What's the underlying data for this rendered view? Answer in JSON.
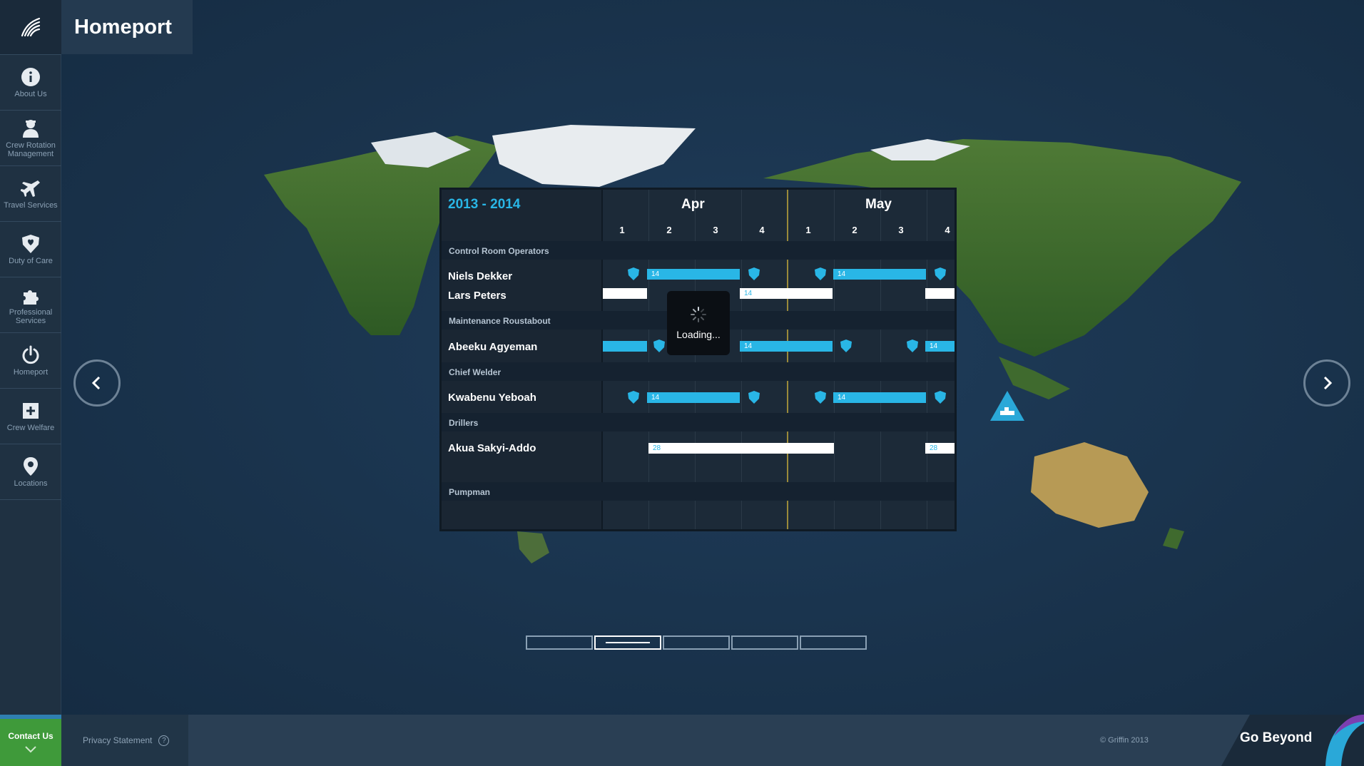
{
  "app": {
    "title": "Homeport"
  },
  "sidebar": {
    "items": [
      {
        "label": "About Us",
        "icon": "info-icon"
      },
      {
        "label": "Crew Rotation Management",
        "icon": "crew-icon"
      },
      {
        "label": "Travel Services",
        "icon": "plane-icon"
      },
      {
        "label": "Duty of Care",
        "icon": "shield-icon"
      },
      {
        "label": "Professional Services",
        "icon": "puzzle-icon"
      },
      {
        "label": "Homeport",
        "icon": "power-icon"
      },
      {
        "label": "Crew Welfare",
        "icon": "plus-box-icon"
      },
      {
        "label": "Locations",
        "icon": "location-pin-icon"
      }
    ]
  },
  "schedule": {
    "year_range": "2013 - 2014",
    "months": [
      "Apr",
      "May"
    ],
    "weeks": [
      "1",
      "2",
      "3",
      "4",
      "1",
      "2",
      "3",
      "4"
    ],
    "groups": [
      {
        "label": "Control Room Operators",
        "people": [
          "Niels Dekker",
          "Lars Peters"
        ]
      },
      {
        "label": "Maintenance Roustabout",
        "people": [
          "Abeeku Agyeman"
        ]
      },
      {
        "label": "Chief Welder",
        "people": [
          "Kwabenu Yeboah"
        ]
      },
      {
        "label": "Drillers",
        "people": [
          "Akua Sakyi-Addo"
        ]
      },
      {
        "label": "Pumpman",
        "people": []
      }
    ],
    "bar_labels": {
      "short": "14",
      "long": "28"
    }
  },
  "loading": {
    "text": "Loading..."
  },
  "footer": {
    "contact": "Contact Us",
    "privacy": "Privacy Statement",
    "copyright": "© Griffin 2013",
    "tagline": "Go Beyond"
  },
  "pager": {
    "pages": 5,
    "active": 2
  },
  "colors": {
    "accent": "#29b6e6",
    "contact": "#3f9a3a",
    "today_line": "#9a8a3a"
  }
}
